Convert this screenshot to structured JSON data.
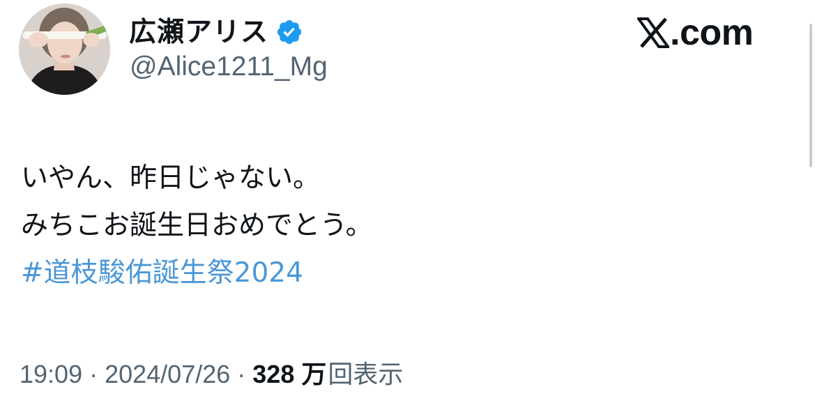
{
  "header": {
    "display_name": "広瀬アリス",
    "handle": "@Alice1211_Mg",
    "verified_icon": "verified-badge-icon",
    "brand_text": ".com",
    "brand_icon": "x-logo-icon"
  },
  "tweet": {
    "lines": [
      "いやん、昨日じゃない。",
      "みちこお誕生日おめでとう。"
    ],
    "hashtag": "#道枝駿佑誕生祭2024"
  },
  "meta": {
    "time": "19:09",
    "date": "2024/07/26",
    "separator": "·",
    "views_count": "328 万",
    "views_label": "回表示"
  },
  "colors": {
    "text_primary": "#0f1419",
    "text_secondary": "#536471",
    "hashtag": "#4a97d6",
    "verified": "#1d9bf0"
  }
}
